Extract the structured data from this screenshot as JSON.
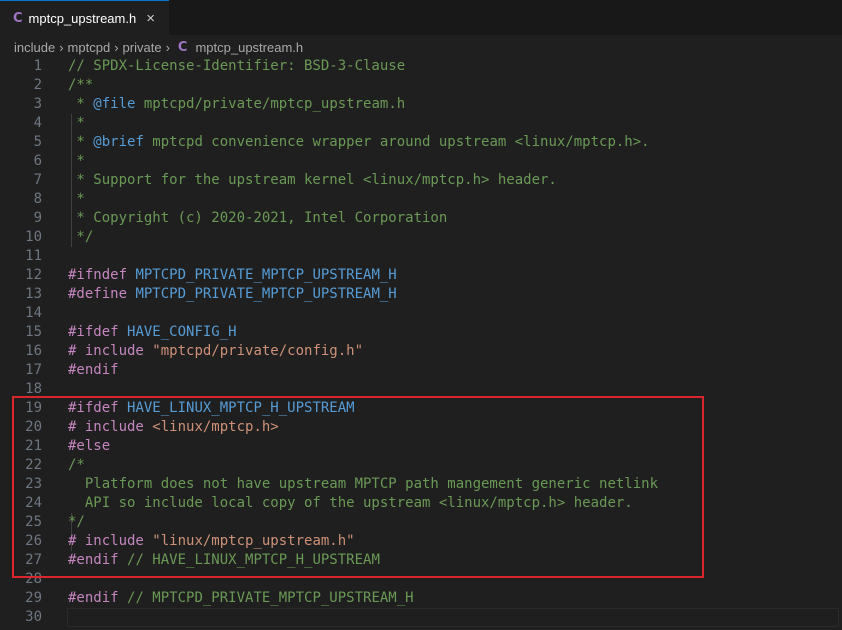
{
  "tab": {
    "icon": "c-language-icon",
    "icon_glyph": "C",
    "label": "mptcp_upstream.h",
    "close": "×"
  },
  "breadcrumb": [
    "include",
    "mptcpd",
    "private"
  ],
  "breadcrumb_file": "mptcp_upstream.h",
  "breadcrumb_separator": "›",
  "highlight_color": "#d9252b",
  "lines": [
    [
      [
        "cm",
        "// SPDX-License-Identifier: BSD-3-Clause"
      ]
    ],
    [
      [
        "cm",
        "/**"
      ]
    ],
    [
      [
        "cm",
        " * "
      ],
      [
        "tg",
        "@file"
      ],
      [
        "cm",
        " mptcpd/private/mptcp_upstream.h"
      ]
    ],
    [
      [
        "cm",
        " *"
      ]
    ],
    [
      [
        "cm",
        " * "
      ],
      [
        "tg",
        "@brief"
      ],
      [
        "cm",
        " mptcpd convenience wrapper around upstream <linux/mptcp.h>."
      ]
    ],
    [
      [
        "cm",
        " *"
      ]
    ],
    [
      [
        "cm",
        " * Support for the upstream kernel <linux/mptcp.h> header."
      ]
    ],
    [
      [
        "cm",
        " *"
      ]
    ],
    [
      [
        "cm",
        " * Copyright (c) 2020-2021, Intel Corporation"
      ]
    ],
    [
      [
        "cm",
        " */"
      ]
    ],
    [],
    [
      [
        "pp",
        "#ifndef "
      ],
      [
        "mc",
        "MPTCPD_PRIVATE_MPTCP_UPSTREAM_H"
      ]
    ],
    [
      [
        "pp",
        "#define "
      ],
      [
        "mc",
        "MPTCPD_PRIVATE_MPTCP_UPSTREAM_H"
      ]
    ],
    [],
    [
      [
        "pp",
        "#ifdef "
      ],
      [
        "mc",
        "HAVE_CONFIG_H"
      ]
    ],
    [
      [
        "pp",
        "# include "
      ],
      [
        "st",
        "\"mptcpd/private/config.h\""
      ]
    ],
    [
      [
        "pp",
        "#endif"
      ]
    ],
    [],
    [
      [
        "pp",
        "#ifdef "
      ],
      [
        "mc",
        "HAVE_LINUX_MPTCP_H_UPSTREAM"
      ]
    ],
    [
      [
        "pp",
        "# include "
      ],
      [
        "st",
        "<linux/mptcp.h>"
      ]
    ],
    [
      [
        "pp",
        "#else"
      ]
    ],
    [
      [
        "cm",
        "/*"
      ]
    ],
    [
      [
        "cm",
        "  Platform does not have upstream MPTCP path mangement generic netlink"
      ]
    ],
    [
      [
        "cm",
        "  API so include local copy of the upstream <linux/mptcp.h> header."
      ]
    ],
    [
      [
        "cm",
        "*/"
      ]
    ],
    [
      [
        "pp",
        "# include "
      ],
      [
        "st",
        "\"linux/mptcp_upstream.h\""
      ]
    ],
    [
      [
        "pp",
        "#endif "
      ],
      [
        "cm",
        "// HAVE_LINUX_MPTCP_H_UPSTREAM"
      ]
    ],
    [],
    [
      [
        "pp",
        "#endif "
      ],
      [
        "cm",
        "// MPTCPD_PRIVATE_MPTCP_UPSTREAM_H"
      ]
    ],
    []
  ]
}
